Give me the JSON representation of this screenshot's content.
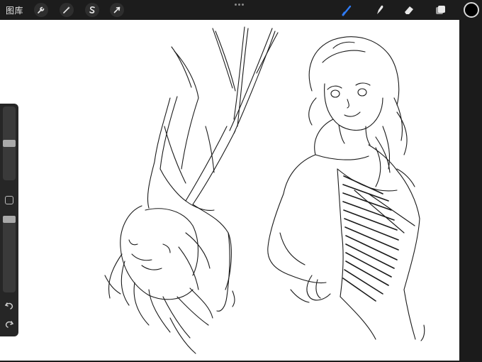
{
  "toolbar": {
    "gallery_label": "图库",
    "left_tools": [
      {
        "name": "actions",
        "icon": "wrench-icon"
      },
      {
        "name": "adjustments",
        "icon": "magic-wand-icon"
      },
      {
        "name": "selection",
        "icon": "selection-s-icon"
      },
      {
        "name": "transform",
        "icon": "arrow-cursor-icon"
      }
    ],
    "more_menu_icon": "ellipsis-icon",
    "right_tools": [
      {
        "name": "brush",
        "icon": "brush-icon",
        "active": true
      },
      {
        "name": "smudge",
        "icon": "smudge-icon",
        "active": false
      },
      {
        "name": "eraser",
        "icon": "eraser-icon",
        "active": false
      },
      {
        "name": "layers",
        "icon": "layers-icon",
        "active": false
      }
    ],
    "current_color": "#000000"
  },
  "colors": {
    "accent": "#2f7cf6",
    "toolbar_bg": "#1c1c1c",
    "canvas_bg": "#ffffff"
  },
  "sidebar": {
    "brush_size_level": 0.5,
    "opacity_level": 0.0,
    "modifier_icon": "square-modifier-icon",
    "undo_icon": "undo-arrow-icon",
    "redo_icon": "redo-arrow-icon"
  }
}
